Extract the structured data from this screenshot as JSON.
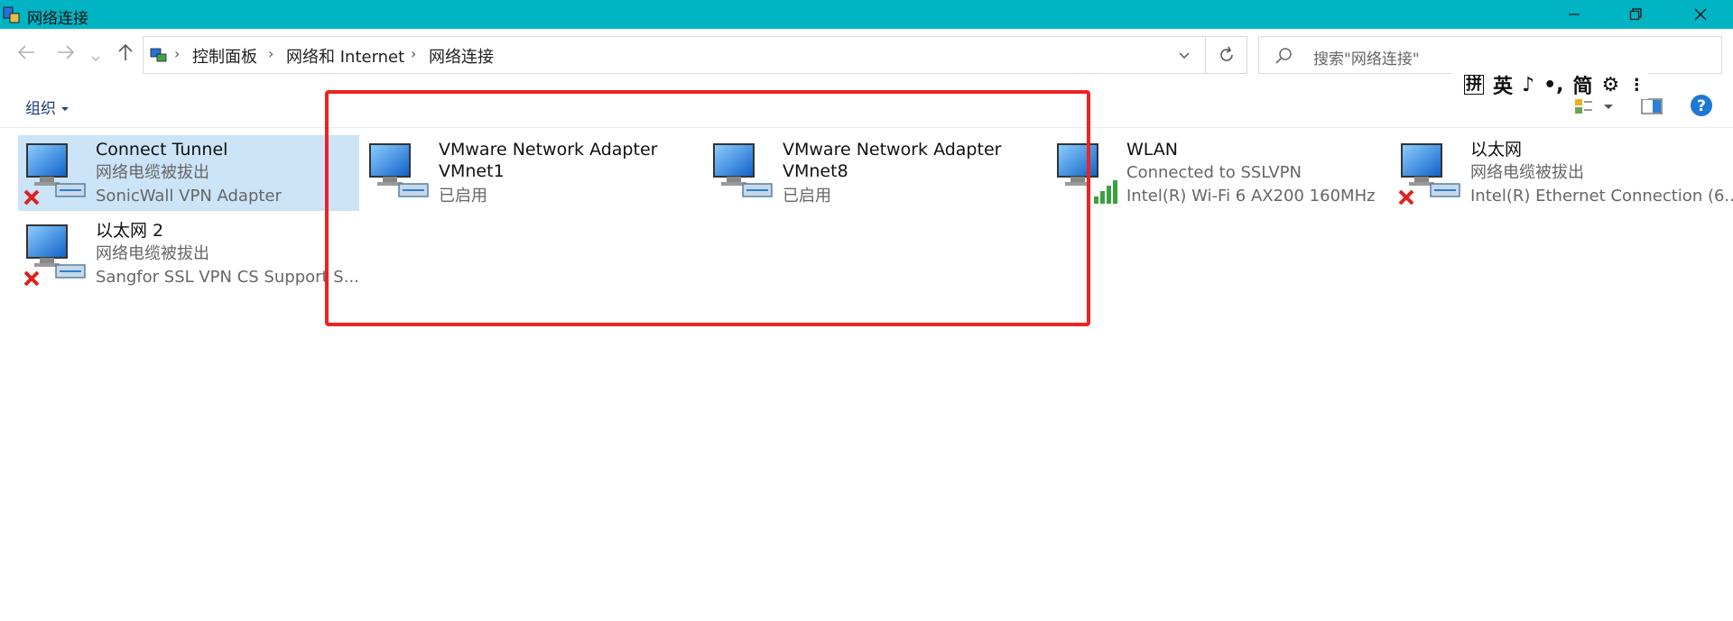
{
  "window": {
    "title": "网络连接"
  },
  "address": {
    "crumbs": [
      "控制面板",
      "网络和 Internet",
      "网络连接"
    ]
  },
  "search": {
    "placeholder": "搜索\"网络连接\""
  },
  "toolbar": {
    "organize_label": "组织"
  },
  "ime": {
    "items": [
      "拼",
      "英",
      "♪",
      "•,",
      "简",
      "⚙",
      "⋮"
    ]
  },
  "adapters": [
    {
      "name": "Connect Tunnel",
      "line1": "网络电缆被拔出",
      "line2": "SonicWall VPN Adapter",
      "status": "disconnected"
    },
    {
      "name": "VMware Network Adapter",
      "name2": "VMnet1",
      "line1": "已启用",
      "status": "enabled"
    },
    {
      "name": "VMware Network Adapter",
      "name2": "VMnet8",
      "line1": "已启用",
      "status": "enabled"
    },
    {
      "name": "WLAN",
      "line1": "Connected to SSLVPN",
      "line2": "Intel(R) Wi-Fi 6 AX200 160MHz",
      "status": "wifi"
    },
    {
      "name": "以太网",
      "line1": "网络电缆被拔出",
      "line2": "Intel(R) Ethernet Connection (6...",
      "status": "disconnected"
    },
    {
      "name": "以太网 2",
      "line1": "网络电缆被拔出",
      "line2": "Sangfor SSL VPN CS Support S...",
      "status": "disconnected"
    }
  ],
  "colors": {
    "titlebar": "#00b4c4",
    "selection": "#cce4f7",
    "highlight": "#ee2222",
    "link": "#1a3c78"
  }
}
